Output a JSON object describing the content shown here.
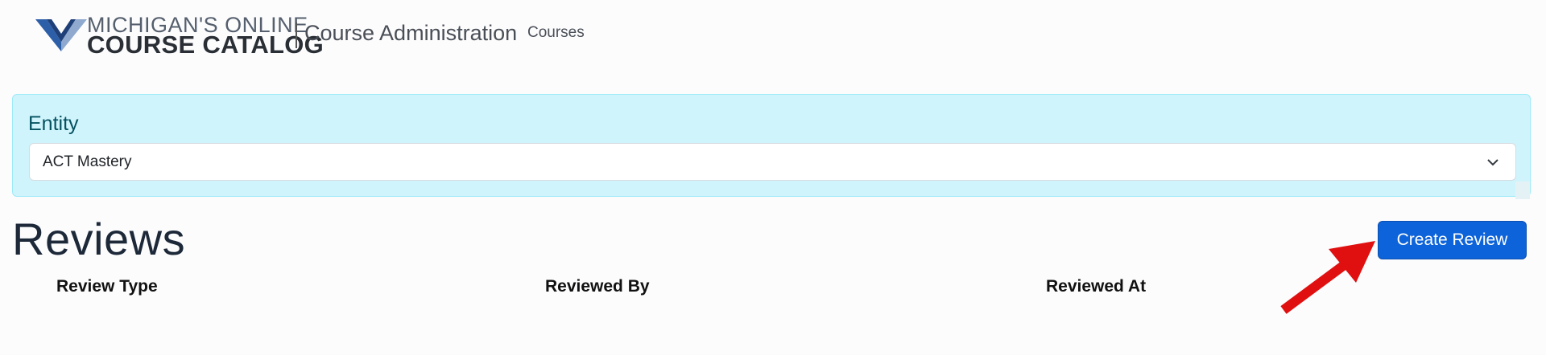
{
  "header": {
    "logo_line1": "MICHIGAN'S ONLINE",
    "logo_line2": "COURSE CATALOG",
    "app_title": "Course Administration",
    "nav": [
      {
        "label": "Courses"
      }
    ]
  },
  "entity": {
    "label": "Entity",
    "selected": "ACT Mastery"
  },
  "reviews": {
    "title": "Reviews",
    "create_button": "Create Review",
    "columns": [
      "Review Type",
      "Reviewed By",
      "Reviewed At"
    ]
  },
  "colors": {
    "panel_bg": "#cff4fc",
    "primary": "#0d63d9",
    "annotation_arrow": "#e01010"
  }
}
